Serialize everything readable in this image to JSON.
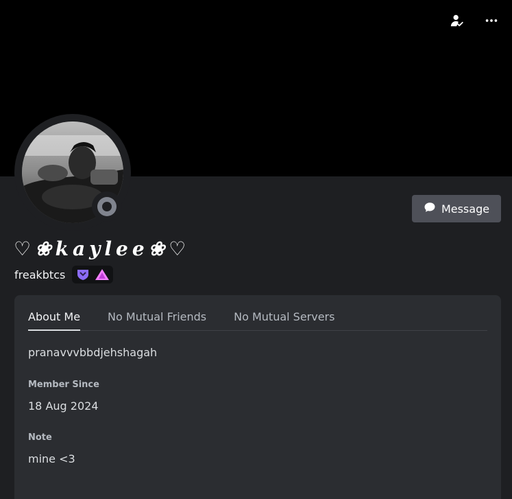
{
  "profile": {
    "display_name": "♡❀kaylee❀♡",
    "username": "freakbtcs",
    "status": "offline"
  },
  "header": {
    "icons": [
      "add-friend-icon",
      "more-options-icon"
    ]
  },
  "actions": {
    "message_label": "Message"
  },
  "badges": [
    {
      "name": "nitro-badge",
      "color": "#8b6cf7"
    },
    {
      "name": "hypesquad-badge",
      "color": "#f47fff"
    }
  ],
  "tabs": [
    {
      "label": "About Me",
      "active": true
    },
    {
      "label": "No Mutual Friends",
      "active": false
    },
    {
      "label": "No Mutual Servers",
      "active": false
    }
  ],
  "about": {
    "bio": "pranavvvbbdjehshagah",
    "member_since_label": "Member Since",
    "member_since_value": "18 Aug 2024",
    "note_label": "Note",
    "note_value": "mine <3"
  },
  "colors": {
    "background": "#1e1f22",
    "banner": "#000000",
    "card": "#2b2d31",
    "button": "#4e5058",
    "status_offline": "#80848e"
  }
}
